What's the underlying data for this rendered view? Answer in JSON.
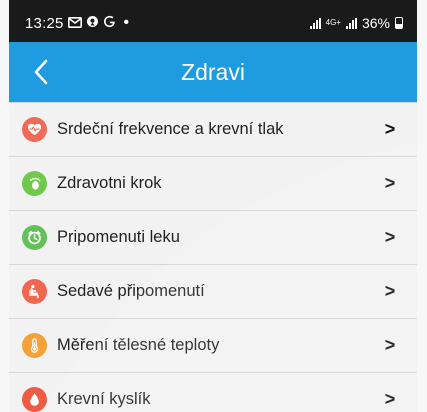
{
  "status_bar": {
    "time": "13:25",
    "network": "4G+",
    "battery": "36%"
  },
  "header": {
    "title": "Zdravi",
    "back_icon": "chevron-left-icon"
  },
  "menu": {
    "items": [
      {
        "label": "Srdeční frekvence a krevní tlak",
        "icon": "heart-pulse-icon",
        "color": "#ef6a57"
      },
      {
        "label": "Zdravotni krok",
        "icon": "footprint-icon",
        "color": "#6fc94a"
      },
      {
        "label": "Pripomenuti leku",
        "icon": "pill-clock-icon",
        "color": "#63c05a"
      },
      {
        "label": "Sedavé připomenutí",
        "icon": "seated-person-icon",
        "color": "#f0664f"
      },
      {
        "label": "Měření tělesné teploty",
        "icon": "thermometer-icon",
        "color": "#f5a13a"
      },
      {
        "label": "Krevní kyslík",
        "icon": "blood-drop-icon",
        "color": "#ef5b44"
      }
    ],
    "chevron": ">"
  },
  "colors": {
    "app_bar": "#1f9be0",
    "status_bar": "#1a1a1a",
    "list_background": "#f2f2f3"
  }
}
